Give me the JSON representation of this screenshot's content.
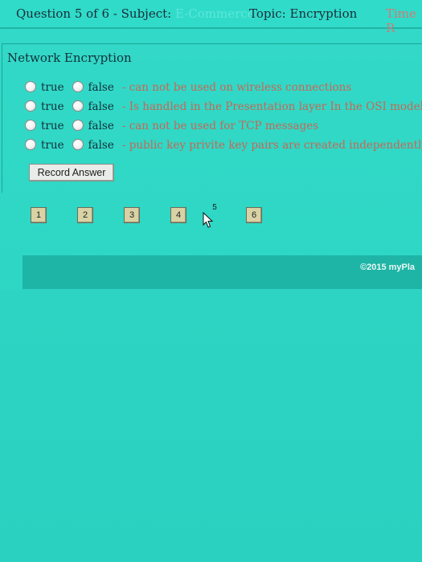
{
  "header": {
    "question_counter": "Question 5 of 6 - Subject:",
    "subject_value": "E-Commerce",
    "topic": "Topic: Encryption",
    "time": "Time R"
  },
  "question": {
    "title": "Network Encryption",
    "rows": [
      {
        "true_label": "true",
        "false_label": "false",
        "statement": "- can not be used on wireless connections"
      },
      {
        "true_label": "true",
        "false_label": "false",
        "statement": "- Is handled in the Presentation layer In the OSI model"
      },
      {
        "true_label": "true",
        "false_label": "false",
        "statement": "- can not be used for TCP messages"
      },
      {
        "true_label": "true",
        "false_label": "false",
        "statement": "- public key privite key pairs are created independently"
      }
    ]
  },
  "actions": {
    "record_answer": "Record Answer"
  },
  "nav": {
    "buttons": [
      "1",
      "2",
      "3",
      "4",
      "5",
      "6"
    ],
    "current": "5"
  },
  "footer": {
    "copyright": "©2015 myPla"
  },
  "icons": {
    "radio": "radio-button-icon",
    "cursor": "mouse-pointer-icon"
  }
}
